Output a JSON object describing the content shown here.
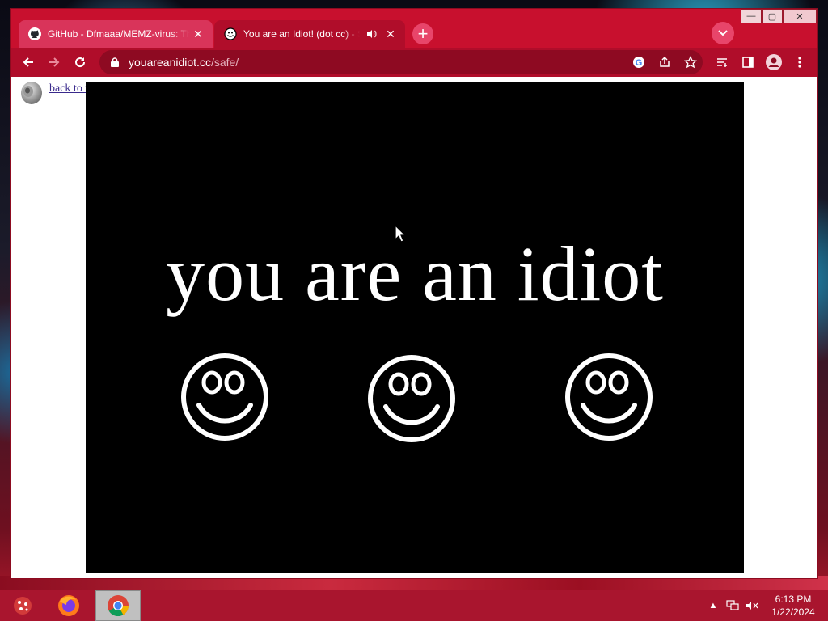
{
  "browser": {
    "tabs": [
      {
        "title": "GitHub - Dfmaaa/MEMZ-virus: Th",
        "active": false,
        "favicon": "github-icon"
      },
      {
        "title": "You are an Idiot! (dot cc) - Sa",
        "active": true,
        "favicon": "smiley-icon",
        "audio": true
      }
    ],
    "new_tab_label": "+",
    "url_host": "youareanidiot.cc",
    "url_path": "/safe/"
  },
  "page": {
    "back_link": "back to the real deal",
    "headline": "you are an idiot"
  },
  "taskbar": {
    "time": "6:13 PM",
    "date": "1/22/2024"
  },
  "colors": {
    "chrome_frame": "#c8102e",
    "toolbar": "#b00d2a",
    "stage_bg": "#000000",
    "stage_fg": "#ffffff"
  }
}
